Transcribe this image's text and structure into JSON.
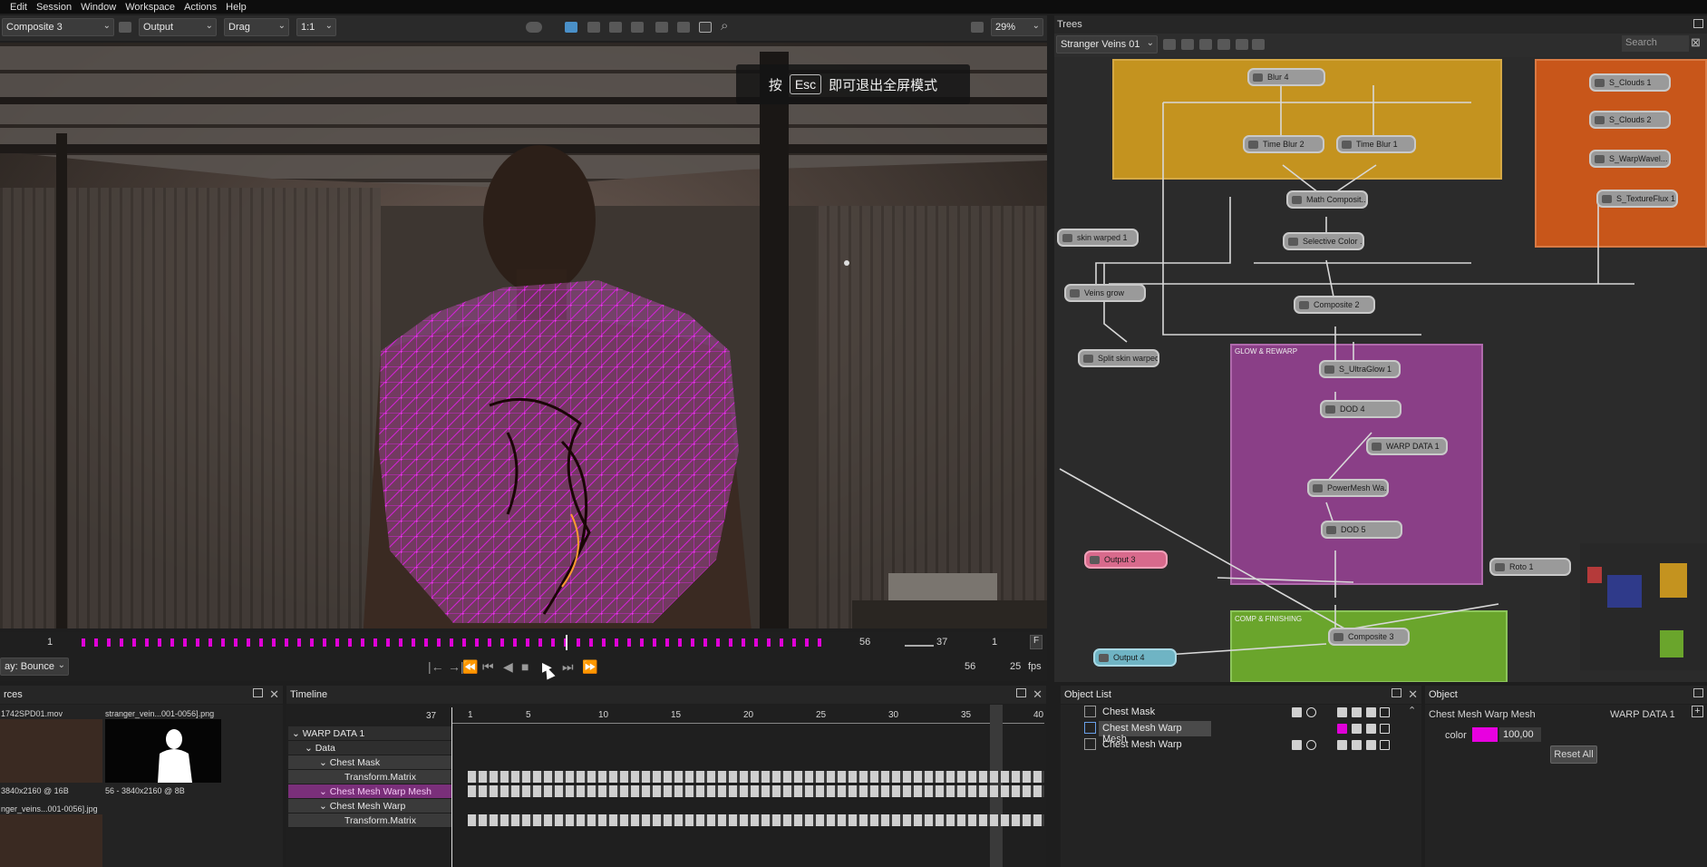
{
  "menubar": {
    "items": [
      "Edit",
      "Session",
      "Window",
      "Workspace",
      "Actions",
      "Help"
    ]
  },
  "viewer_toolbar": {
    "node_select": "Composite 3",
    "view_select": "Output",
    "mode_select": "Drag",
    "ratio_select": "1:1",
    "zoom_select": "29%"
  },
  "fullscreen_tip": {
    "prefix": "按",
    "key": "Esc",
    "suffix": "即可退出全屏模式"
  },
  "frame_strip": {
    "start": "1",
    "end": "56",
    "current": "37",
    "step": "1",
    "f_button": "F"
  },
  "transport": {
    "playback_mode": "ay: Bounce",
    "frame": "56",
    "fps_value": "25",
    "fps_label": "fps"
  },
  "sources": {
    "title": "rces",
    "items": [
      {
        "name": "1742SPD01.mov",
        "info": "3840x2160 @ 16B"
      },
      {
        "name": "stranger_vein...001-0056].png",
        "info": "56 - 3840x2160 @ 8B"
      },
      {
        "name": "nger_veins...001-0056].jpg",
        "info": ""
      }
    ]
  },
  "timeline": {
    "title": "Timeline",
    "current_frame": "37",
    "ticks": [
      "1",
      "5",
      "10",
      "15",
      "20",
      "25",
      "30",
      "35",
      "40"
    ],
    "rows": [
      {
        "label": "WARP DATA 1",
        "level": 0,
        "expanded": true
      },
      {
        "label": "Data",
        "level": 1,
        "expanded": true
      },
      {
        "label": "Chest Mask",
        "level": 2,
        "expanded": true
      },
      {
        "label": "Transform.Matrix",
        "level": 3,
        "expanded": false
      },
      {
        "label": "Chest Mesh Warp Mesh",
        "level": 2,
        "expanded": true,
        "selected": true
      },
      {
        "label": "Chest Mesh Warp",
        "level": 2,
        "expanded": true
      },
      {
        "label": "Transform.Matrix",
        "level": 3,
        "expanded": false
      }
    ]
  },
  "trees": {
    "title": "Trees",
    "tree_select": "Stranger Veins 01",
    "search_placeholder": "Search",
    "groups": [
      {
        "label": "GLOW & REWARP",
        "color": "#8a3f87"
      },
      {
        "label": "COMP & FINISHING",
        "color": "#6aa52c"
      }
    ],
    "nodes": [
      "Blur 4",
      "Time Blur 2",
      "Time Blur 1",
      "Math Composit...",
      "Selective Color ...",
      "skin warped 1",
      "Veins grow",
      "Composite 2",
      "Split skin warped",
      "S_UltraGlow 1",
      "DOD 4",
      "WARP DATA 1",
      "PowerMesh Wa...",
      "DOD 5",
      "Output 3",
      "Roto 1",
      "Composite 3",
      "Output 4",
      "S_Clouds 1",
      "S_Clouds 2",
      "S_WarpWavel...",
      "S_TextureFlux 1"
    ]
  },
  "object_list": {
    "title": "Object List",
    "items": [
      {
        "label": "Chest Mask",
        "selected": false
      },
      {
        "label": "Chest Mesh Warp Mesh",
        "selected": true
      },
      {
        "label": "Chest Mesh Warp",
        "selected": false
      }
    ]
  },
  "object": {
    "title": "Object",
    "name": "Chest Mesh Warp Mesh",
    "parent": "WARP DATA 1",
    "color_label": "color",
    "color_value": "100,00",
    "color_swatch": "#e800e0",
    "reset_label": "Reset All"
  }
}
